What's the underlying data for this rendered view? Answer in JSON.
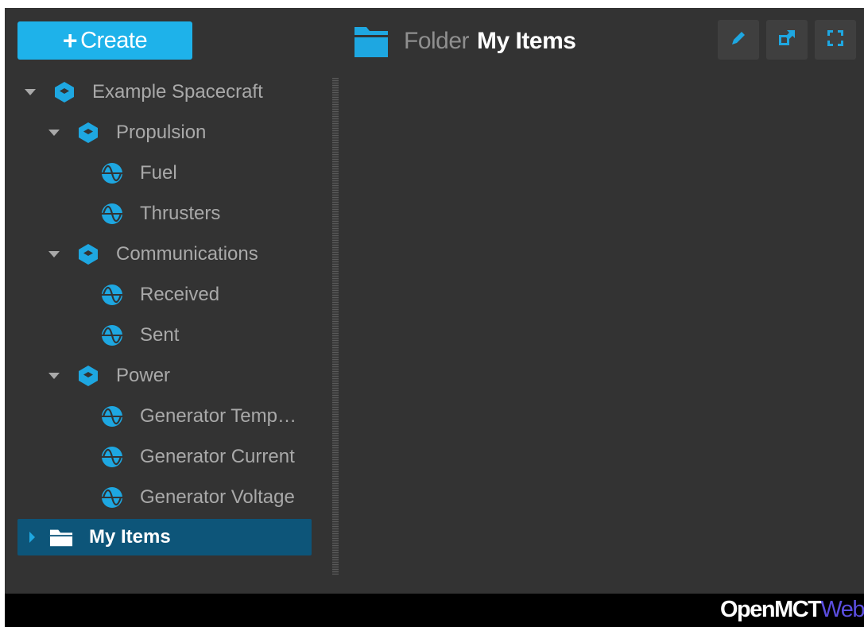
{
  "create_button": {
    "label": "Create",
    "icon": "plus-icon"
  },
  "tree": {
    "items": [
      {
        "label": "Example Spacecraft",
        "icon": "cube-icon",
        "expanded": true
      },
      {
        "label": "Propulsion",
        "icon": "cube-icon",
        "expanded": true
      },
      {
        "label": "Fuel",
        "icon": "telemetry-icon"
      },
      {
        "label": "Thrusters",
        "icon": "telemetry-icon"
      },
      {
        "label": "Communications",
        "icon": "cube-icon",
        "expanded": true
      },
      {
        "label": "Received",
        "icon": "telemetry-icon"
      },
      {
        "label": "Sent",
        "icon": "telemetry-icon"
      },
      {
        "label": "Power",
        "icon": "cube-icon",
        "expanded": true
      },
      {
        "label": "Generator Temp…",
        "icon": "telemetry-icon"
      },
      {
        "label": "Generator Current",
        "icon": "telemetry-icon"
      },
      {
        "label": "Generator Voltage",
        "icon": "telemetry-icon"
      },
      {
        "label": "My Items",
        "icon": "folder-icon",
        "expanded": false,
        "selected": true
      }
    ]
  },
  "object_header": {
    "type_label": "Folder",
    "name": "My Items",
    "icon": "folder-icon"
  },
  "toolbar": {
    "edit_icon": "pencil-icon",
    "new_window_icon": "new-window-icon",
    "fullscreen_icon": "fullscreen-icon"
  },
  "footer": {
    "brand_primary": "OpenMCT",
    "brand_secondary": "Web"
  },
  "colors": {
    "accent": "#1eb2ea",
    "selection": "#0d5579",
    "background": "#333333",
    "footer": "#000000",
    "brand_secondary": "#5b4ee0"
  }
}
